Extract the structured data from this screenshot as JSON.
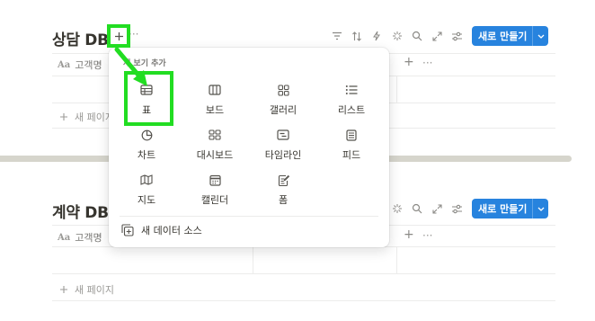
{
  "top_db": {
    "title": "상담 DB",
    "add_icon": "plus-icon",
    "more": "···",
    "column_name": "고객명",
    "column_icon": "Aa",
    "add_column": "+",
    "more_columns": "···",
    "new_page": "새 페이지",
    "new_button": "새로 만들기"
  },
  "bottom_db": {
    "title": "계약 DB",
    "column_name": "고객명",
    "column_icon": "Aa",
    "add_column": "+",
    "more_columns": "···",
    "new_page": "새 페이지",
    "new_button": "새로 만들기"
  },
  "toolbar_icons": [
    "filter-icon",
    "sort-icon",
    "automation-bolt-icon",
    "ai-sparkle-icon",
    "search-icon",
    "expand-icon",
    "settings-sliders-icon"
  ],
  "view_menu": {
    "title": "새 보기 추가",
    "options": [
      {
        "label": "표",
        "icon": "table-icon"
      },
      {
        "label": "보드",
        "icon": "board-icon"
      },
      {
        "label": "갤러리",
        "icon": "gallery-icon"
      },
      {
        "label": "리스트",
        "icon": "list-icon"
      },
      {
        "label": "차트",
        "icon": "chart-icon"
      },
      {
        "label": "대시보드",
        "icon": "dashboard-icon"
      },
      {
        "label": "타임라인",
        "icon": "timeline-icon"
      },
      {
        "label": "피드",
        "icon": "feed-icon"
      },
      {
        "label": "지도",
        "icon": "map-icon"
      },
      {
        "label": "캘린더",
        "icon": "calendar-icon"
      },
      {
        "label": "폼",
        "icon": "form-icon"
      }
    ],
    "new_source": "새 데이터 소스"
  },
  "colors": {
    "accent": "#2783de",
    "highlight": "#22dd22",
    "divider": "#d6d5cc"
  }
}
